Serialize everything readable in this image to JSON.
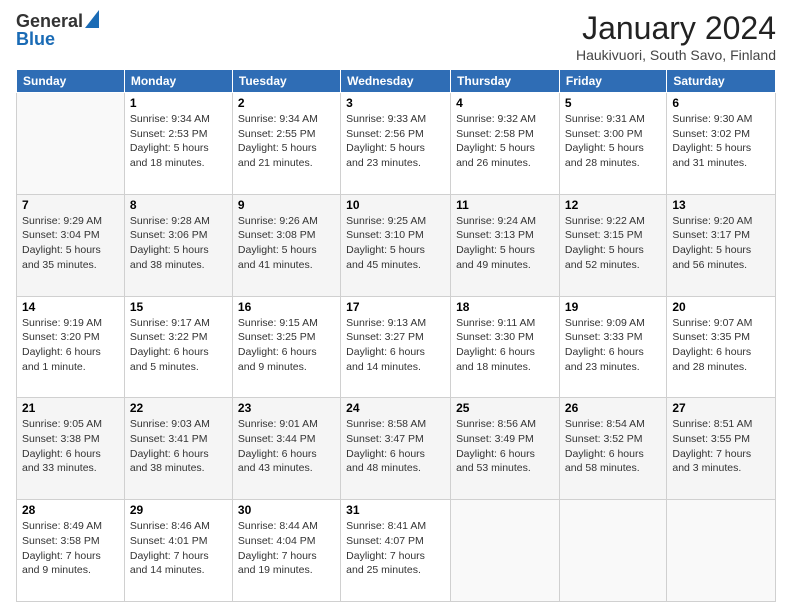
{
  "header": {
    "logo_general": "General",
    "logo_blue": "Blue",
    "month_title": "January 2024",
    "location": "Haukivuori, South Savo, Finland"
  },
  "days_of_week": [
    "Sunday",
    "Monday",
    "Tuesday",
    "Wednesday",
    "Thursday",
    "Friday",
    "Saturday"
  ],
  "weeks": [
    [
      {
        "day": "",
        "sunrise": "",
        "sunset": "",
        "daylight": ""
      },
      {
        "day": "1",
        "sunrise": "Sunrise: 9:34 AM",
        "sunset": "Sunset: 2:53 PM",
        "daylight": "Daylight: 5 hours and 18 minutes."
      },
      {
        "day": "2",
        "sunrise": "Sunrise: 9:34 AM",
        "sunset": "Sunset: 2:55 PM",
        "daylight": "Daylight: 5 hours and 21 minutes."
      },
      {
        "day": "3",
        "sunrise": "Sunrise: 9:33 AM",
        "sunset": "Sunset: 2:56 PM",
        "daylight": "Daylight: 5 hours and 23 minutes."
      },
      {
        "day": "4",
        "sunrise": "Sunrise: 9:32 AM",
        "sunset": "Sunset: 2:58 PM",
        "daylight": "Daylight: 5 hours and 26 minutes."
      },
      {
        "day": "5",
        "sunrise": "Sunrise: 9:31 AM",
        "sunset": "Sunset: 3:00 PM",
        "daylight": "Daylight: 5 hours and 28 minutes."
      },
      {
        "day": "6",
        "sunrise": "Sunrise: 9:30 AM",
        "sunset": "Sunset: 3:02 PM",
        "daylight": "Daylight: 5 hours and 31 minutes."
      }
    ],
    [
      {
        "day": "7",
        "sunrise": "Sunrise: 9:29 AM",
        "sunset": "Sunset: 3:04 PM",
        "daylight": "Daylight: 5 hours and 35 minutes."
      },
      {
        "day": "8",
        "sunrise": "Sunrise: 9:28 AM",
        "sunset": "Sunset: 3:06 PM",
        "daylight": "Daylight: 5 hours and 38 minutes."
      },
      {
        "day": "9",
        "sunrise": "Sunrise: 9:26 AM",
        "sunset": "Sunset: 3:08 PM",
        "daylight": "Daylight: 5 hours and 41 minutes."
      },
      {
        "day": "10",
        "sunrise": "Sunrise: 9:25 AM",
        "sunset": "Sunset: 3:10 PM",
        "daylight": "Daylight: 5 hours and 45 minutes."
      },
      {
        "day": "11",
        "sunrise": "Sunrise: 9:24 AM",
        "sunset": "Sunset: 3:13 PM",
        "daylight": "Daylight: 5 hours and 49 minutes."
      },
      {
        "day": "12",
        "sunrise": "Sunrise: 9:22 AM",
        "sunset": "Sunset: 3:15 PM",
        "daylight": "Daylight: 5 hours and 52 minutes."
      },
      {
        "day": "13",
        "sunrise": "Sunrise: 9:20 AM",
        "sunset": "Sunset: 3:17 PM",
        "daylight": "Daylight: 5 hours and 56 minutes."
      }
    ],
    [
      {
        "day": "14",
        "sunrise": "Sunrise: 9:19 AM",
        "sunset": "Sunset: 3:20 PM",
        "daylight": "Daylight: 6 hours and 1 minute."
      },
      {
        "day": "15",
        "sunrise": "Sunrise: 9:17 AM",
        "sunset": "Sunset: 3:22 PM",
        "daylight": "Daylight: 6 hours and 5 minutes."
      },
      {
        "day": "16",
        "sunrise": "Sunrise: 9:15 AM",
        "sunset": "Sunset: 3:25 PM",
        "daylight": "Daylight: 6 hours and 9 minutes."
      },
      {
        "day": "17",
        "sunrise": "Sunrise: 9:13 AM",
        "sunset": "Sunset: 3:27 PM",
        "daylight": "Daylight: 6 hours and 14 minutes."
      },
      {
        "day": "18",
        "sunrise": "Sunrise: 9:11 AM",
        "sunset": "Sunset: 3:30 PM",
        "daylight": "Daylight: 6 hours and 18 minutes."
      },
      {
        "day": "19",
        "sunrise": "Sunrise: 9:09 AM",
        "sunset": "Sunset: 3:33 PM",
        "daylight": "Daylight: 6 hours and 23 minutes."
      },
      {
        "day": "20",
        "sunrise": "Sunrise: 9:07 AM",
        "sunset": "Sunset: 3:35 PM",
        "daylight": "Daylight: 6 hours and 28 minutes."
      }
    ],
    [
      {
        "day": "21",
        "sunrise": "Sunrise: 9:05 AM",
        "sunset": "Sunset: 3:38 PM",
        "daylight": "Daylight: 6 hours and 33 minutes."
      },
      {
        "day": "22",
        "sunrise": "Sunrise: 9:03 AM",
        "sunset": "Sunset: 3:41 PM",
        "daylight": "Daylight: 6 hours and 38 minutes."
      },
      {
        "day": "23",
        "sunrise": "Sunrise: 9:01 AM",
        "sunset": "Sunset: 3:44 PM",
        "daylight": "Daylight: 6 hours and 43 minutes."
      },
      {
        "day": "24",
        "sunrise": "Sunrise: 8:58 AM",
        "sunset": "Sunset: 3:47 PM",
        "daylight": "Daylight: 6 hours and 48 minutes."
      },
      {
        "day": "25",
        "sunrise": "Sunrise: 8:56 AM",
        "sunset": "Sunset: 3:49 PM",
        "daylight": "Daylight: 6 hours and 53 minutes."
      },
      {
        "day": "26",
        "sunrise": "Sunrise: 8:54 AM",
        "sunset": "Sunset: 3:52 PM",
        "daylight": "Daylight: 6 hours and 58 minutes."
      },
      {
        "day": "27",
        "sunrise": "Sunrise: 8:51 AM",
        "sunset": "Sunset: 3:55 PM",
        "daylight": "Daylight: 7 hours and 3 minutes."
      }
    ],
    [
      {
        "day": "28",
        "sunrise": "Sunrise: 8:49 AM",
        "sunset": "Sunset: 3:58 PM",
        "daylight": "Daylight: 7 hours and 9 minutes."
      },
      {
        "day": "29",
        "sunrise": "Sunrise: 8:46 AM",
        "sunset": "Sunset: 4:01 PM",
        "daylight": "Daylight: 7 hours and 14 minutes."
      },
      {
        "day": "30",
        "sunrise": "Sunrise: 8:44 AM",
        "sunset": "Sunset: 4:04 PM",
        "daylight": "Daylight: 7 hours and 19 minutes."
      },
      {
        "day": "31",
        "sunrise": "Sunrise: 8:41 AM",
        "sunset": "Sunset: 4:07 PM",
        "daylight": "Daylight: 7 hours and 25 minutes."
      },
      {
        "day": "",
        "sunrise": "",
        "sunset": "",
        "daylight": ""
      },
      {
        "day": "",
        "sunrise": "",
        "sunset": "",
        "daylight": ""
      },
      {
        "day": "",
        "sunrise": "",
        "sunset": "",
        "daylight": ""
      }
    ]
  ]
}
